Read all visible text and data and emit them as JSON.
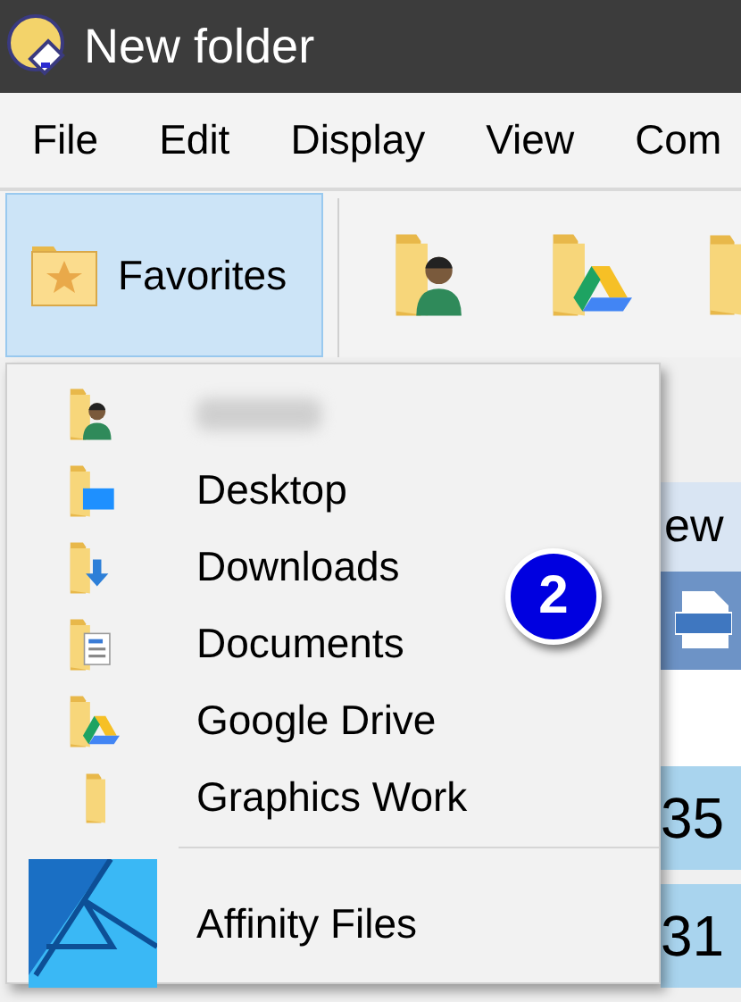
{
  "window": {
    "title": "New folder"
  },
  "menu_bar": [
    "File",
    "Edit",
    "Display",
    "View",
    "Com"
  ],
  "toolbar": {
    "favorites": {
      "label": "Favorites",
      "selected": true
    },
    "icons": [
      {
        "kind": "person"
      },
      {
        "kind": "drive"
      },
      {
        "kind": "plain"
      }
    ]
  },
  "favorites_menu": {
    "items": [
      {
        "kind": "person",
        "blurred": true
      },
      {
        "kind": "desktop",
        "label": "Desktop",
        "blurred": false
      },
      {
        "kind": "download",
        "label": "Downloads",
        "blurred": false
      },
      {
        "kind": "document",
        "label": "Documents",
        "blurred": false
      },
      {
        "kind": "drive",
        "label": "Google Drive",
        "blurred": false
      },
      {
        "kind": "plain",
        "label": "Graphics Work",
        "blurred": false
      }
    ],
    "footer": {
      "label": "Affinity Files"
    }
  },
  "badge": "2",
  "background_list": {
    "header": "ew",
    "rows": [
      "35",
      "31"
    ]
  }
}
